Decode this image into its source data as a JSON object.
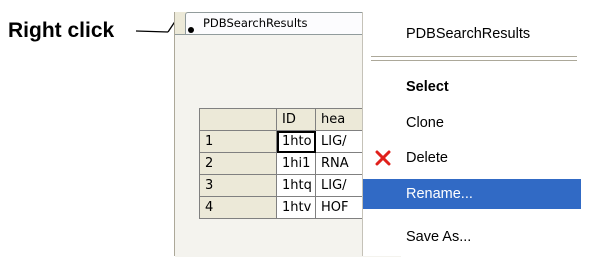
{
  "annotation": {
    "label": "Right click"
  },
  "tab": {
    "label": "PDBSearchResults"
  },
  "table": {
    "columns": [
      "",
      "ID",
      "hea"
    ],
    "rows": [
      {
        "num": "1",
        "id": "1hto",
        "header": "LIG/"
      },
      {
        "num": "2",
        "id": "1hi1",
        "header": "RNA"
      },
      {
        "num": "3",
        "id": "1htq",
        "header": "LIG/"
      },
      {
        "num": "4",
        "id": "1htv",
        "header": "HOF"
      }
    ]
  },
  "menu": {
    "title": "PDBSearchResults",
    "select": "Select",
    "clone": "Clone",
    "delete": "Delete",
    "rename": "Rename...",
    "save_as": "Save As..."
  },
  "colors": {
    "highlight": "#316ac5",
    "delete_icon": "#e0201b"
  }
}
